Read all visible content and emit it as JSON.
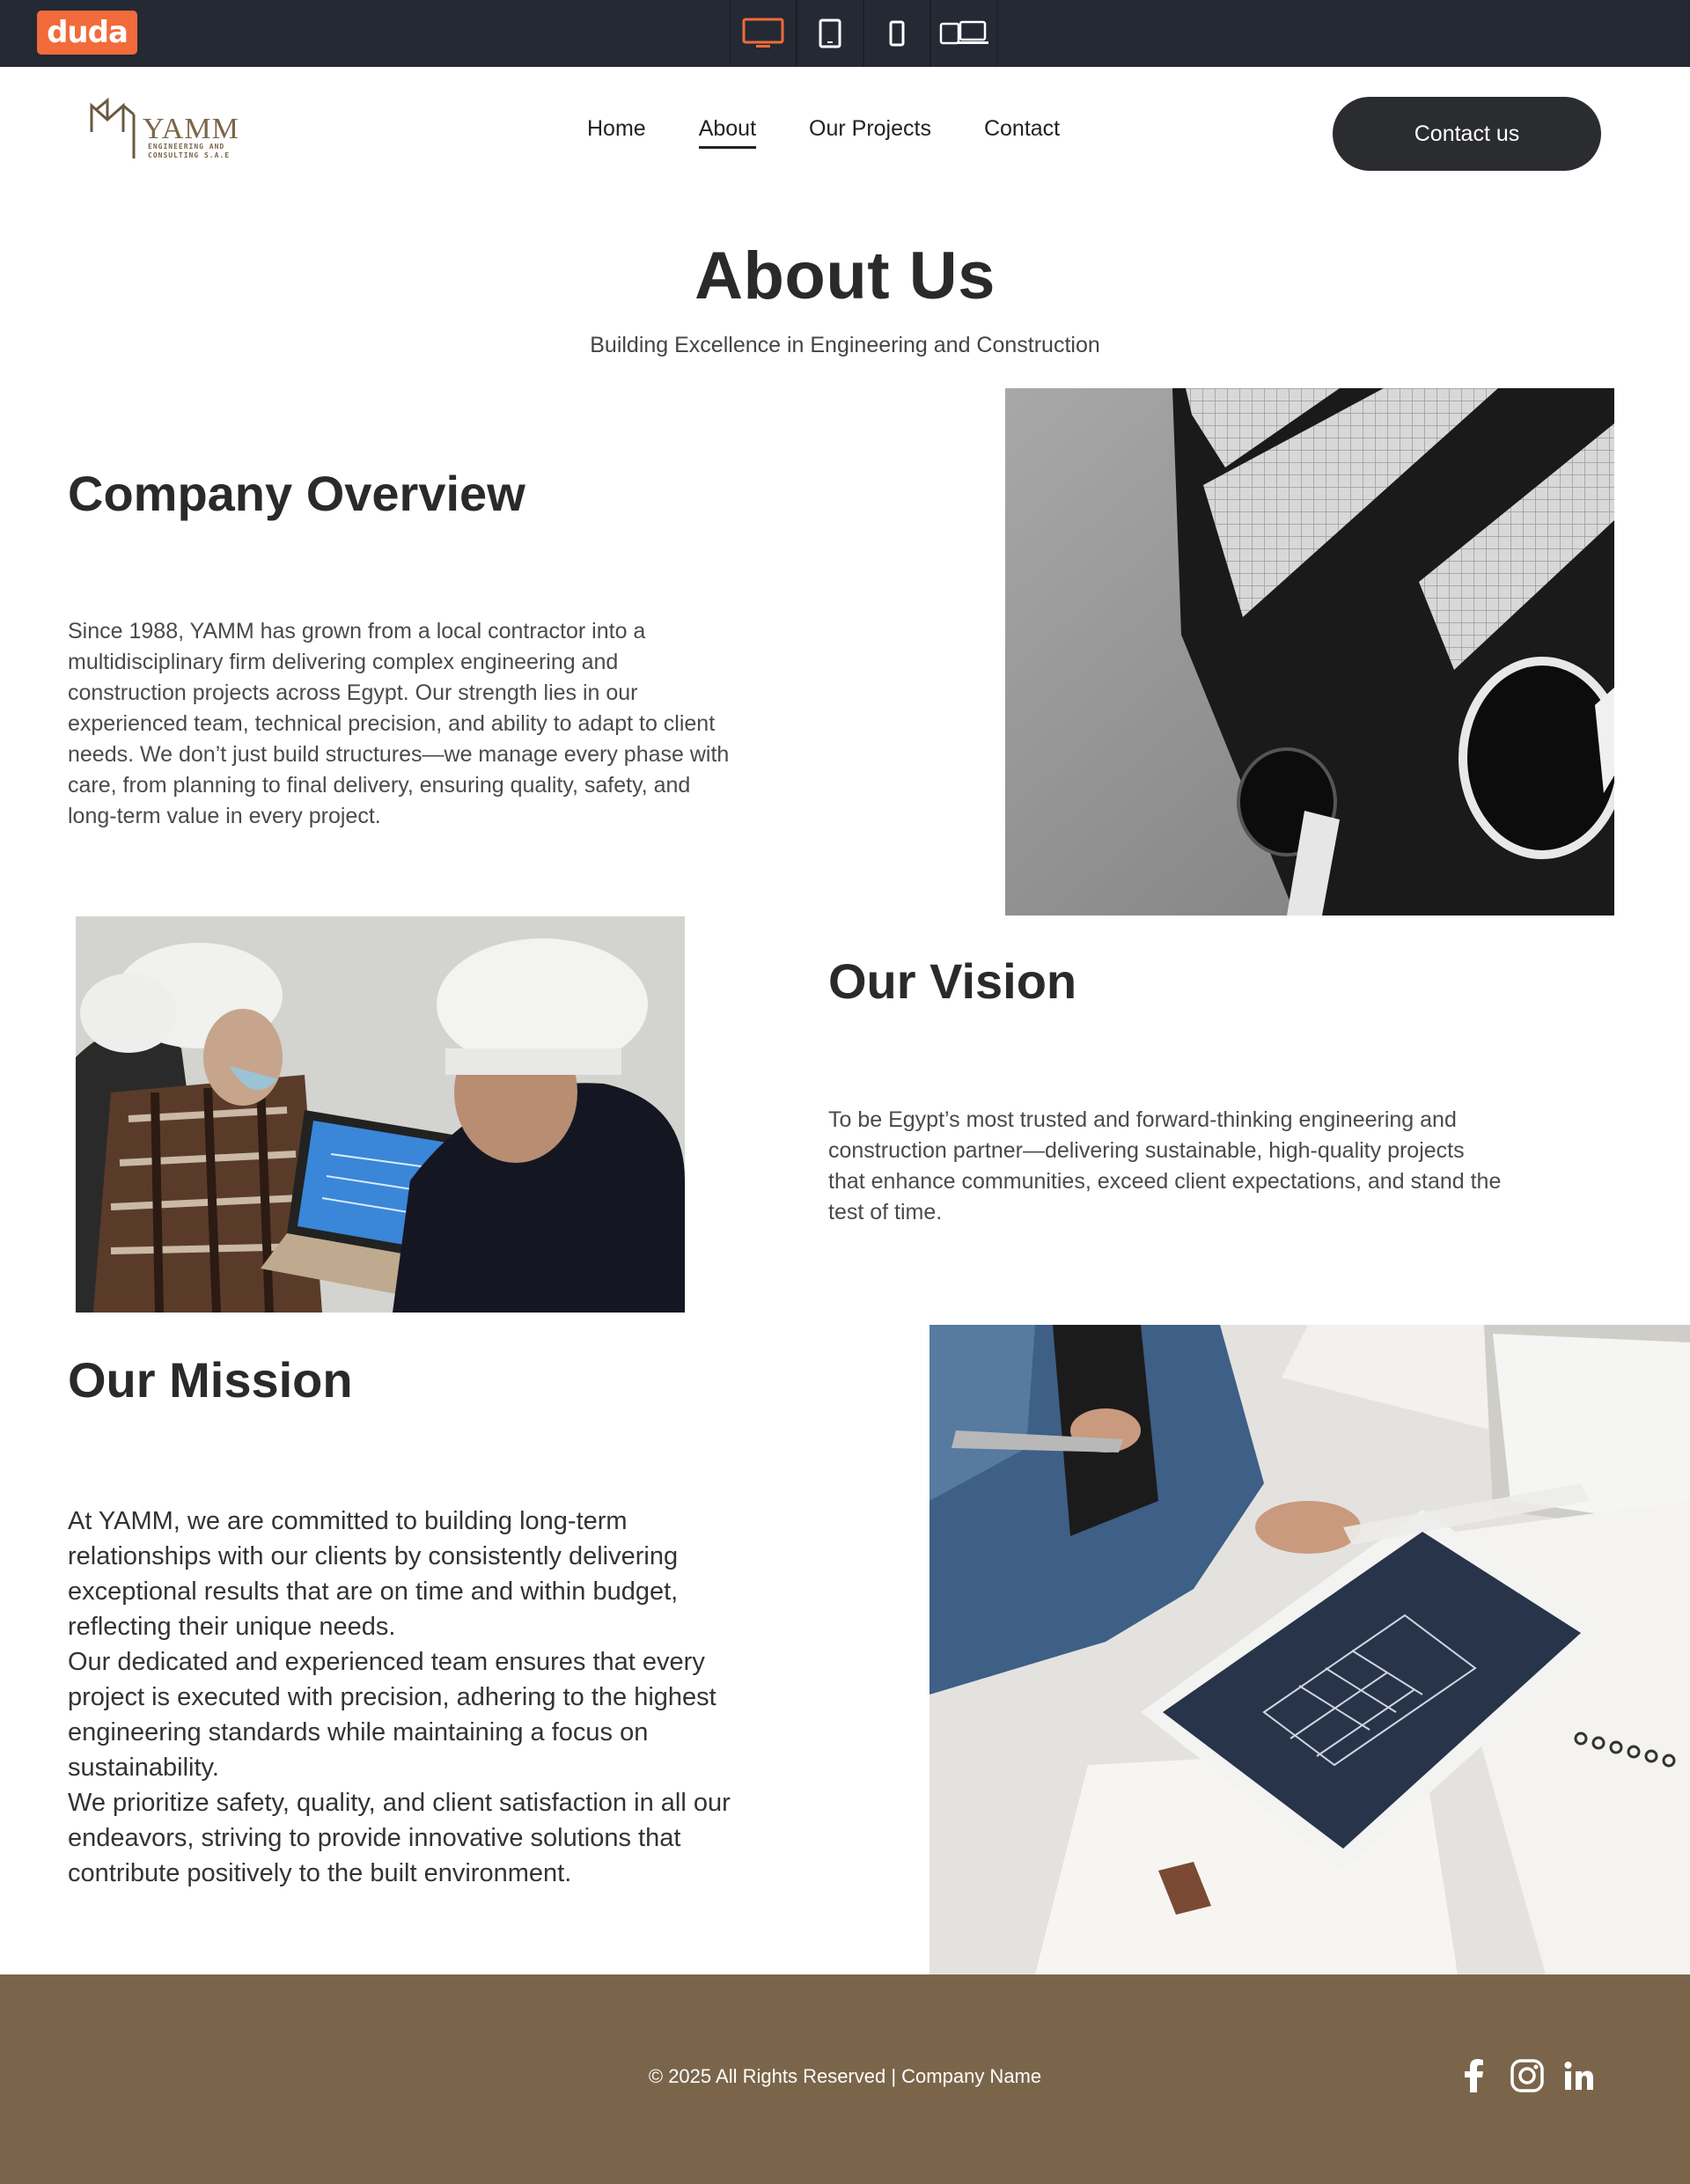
{
  "editor": {
    "logo": "duda",
    "devices": [
      {
        "name": "desktop",
        "active": true
      },
      {
        "name": "tablet"
      },
      {
        "name": "mobile"
      },
      {
        "name": "responsive"
      }
    ],
    "accent": "#f26b3a"
  },
  "header": {
    "brand_name": "YAMM",
    "brand_tagline_1": "ENGINEERING AND",
    "brand_tagline_2": "CONSULTING S.A.E",
    "nav": [
      "Home",
      "About",
      "Our Projects",
      "Contact"
    ],
    "active_nav": "About",
    "cta": "Contact us"
  },
  "hero": {
    "title": "About Us",
    "subtitle": "Building Excellence in Engineering and Construction"
  },
  "overview": {
    "title": "Company Overview",
    "lines": [
      "Since 1988, YAMM has grown from a local contractor into a",
      "multidisciplinary firm delivering complex engineering and",
      "construction projects across Egypt. Our strength lies in our",
      "experienced team, technical precision, and ability to adapt to client",
      "needs. We don’t just build structures—we manage every phase with",
      "care, from planning to final delivery, ensuring quality, safety, and",
      "long-term value in every project."
    ]
  },
  "vision": {
    "title": "Our Vision",
    "lines": [
      "To be Egypt’s most trusted and forward-thinking engineering and",
      "construction partner—delivering sustainable, high-quality projects",
      "that enhance communities, exceed client expectations, and stand the",
      "test of time."
    ]
  },
  "mission": {
    "title": "Our Mission",
    "lines": [
      "At YAMM, we are committed to building long-term",
      "relationships with our clients by consistently delivering",
      "exceptional results that are on time and within budget,",
      "reflecting their unique needs.",
      "Our dedicated and experienced team ensures that every",
      "project is executed with precision, adhering to the highest",
      "engineering standards while maintaining a focus on",
      "sustainability.",
      "We prioritize safety, quality, and client satisfaction in all our",
      "endeavors, striving to provide innovative solutions that",
      "contribute positively to the built environment."
    ]
  },
  "footer": {
    "copyright": "© 2025 All Rights Reserved | Company Name",
    "social": [
      "facebook-icon",
      "instagram-icon",
      "linkedin-icon"
    ],
    "background": "#7b654a"
  }
}
